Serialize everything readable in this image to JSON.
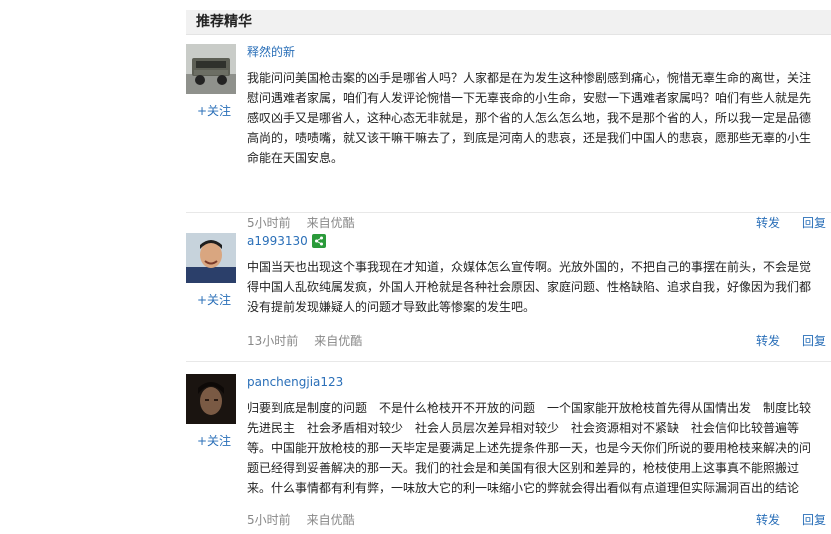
{
  "section": {
    "title": "推荐精华"
  },
  "posts": [
    {
      "username": "释然的新",
      "follow_label": "+关注",
      "content": "我能问问美国枪击案的凶手是哪省人吗？人家都是在为发生这种惨剧感到痛心，惋惜无辜生命的离世，关注慰问遇难者家属，咱们有人发评论惋惜一下无辜丧命的小生命，安慰一下遇难者家属吗？咱们有些人就是先感叹凶手又是哪省人，这种心态无非就是，那个省的人怎么怎么地，我不是那个省的人，所以我一定是品德高尚的，啧啧嘴，就又该干嘛干嘛去了，到底是河南人的悲哀，还是我们中国人的悲哀，愿那些无辜的小生命能在天国安息。",
      "time": "5小时前",
      "source": "来自优酷",
      "repost_label": "转发",
      "reply_label": "回复"
    },
    {
      "username": "a1993130",
      "follow_label": "+关注",
      "content": "中国当天也出现这个事我现在才知道，众媒体怎么宣传啊。光放外国的，不把自己的事摆在前头，不会是觉得中国人乱砍纯属发疯，外国人开枪就是各种社会原因、家庭问题、性格缺陷、追求自我，好像因为我们都没有提前发现嫌疑人的问题才导致此等惨案的发生吧。",
      "time": "13小时前",
      "source": "来自优酷",
      "repost_label": "转发",
      "reply_label": "回复"
    },
    {
      "username": "panchengjia123",
      "follow_label": "+关注",
      "content": "归要到底是制度的问题　不是什么枪枝开不开放的问题　一个国家能开放枪枝首先得从国情出发　制度比较先进民主　社会矛盾相对较少　社会人员层次差异相对较少　社会资源相对不紧缺　社会信仰比较普遍等等。中国能开放枪枝的那一天毕定是要满足上述先提条件那一天，也是今天你们所说的要用枪枝来解决的问题已经得到妥善解决的那一天。我们的社会是和美国有很大区别和差异的，枪枝使用上这事真不能照搬过来。什么事情都有利有弊，一味放大它的利一味缩小它的弊就会得出看似有点道理但实际漏洞百出的结论",
      "time": "5小时前",
      "source": "来自优酷",
      "repost_label": "转发",
      "reply_label": "回复"
    }
  ]
}
